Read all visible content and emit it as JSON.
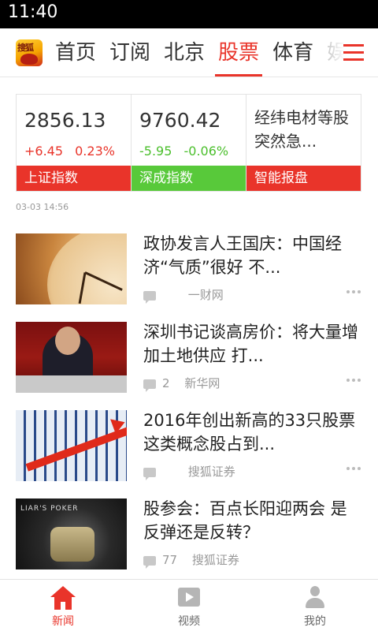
{
  "status_bar": {
    "time": "11:40"
  },
  "header": {
    "logo_text": "搜狐",
    "tabs": [
      {
        "label": "首页"
      },
      {
        "label": "订阅"
      },
      {
        "label": "北京"
      },
      {
        "label": "股票",
        "active": true
      },
      {
        "label": "体育"
      },
      {
        "label": "娱"
      }
    ],
    "menu_icon": "hamburger-menu-icon"
  },
  "market": {
    "indices": [
      {
        "value": "2856.13",
        "change": "+6.45",
        "percent": "0.23%",
        "name": "上证指数",
        "trend": "up",
        "color": "#e9342a"
      },
      {
        "value": "9760.42",
        "change": "-5.95",
        "percent": "-0.06%",
        "name": "深成指数",
        "trend": "down",
        "color": "#58c93a"
      }
    ],
    "smart_report": {
      "text": "经纬电材等股突然急...",
      "name": "智能报盘",
      "color": "#e9342a"
    }
  },
  "update_time": "03-03 14:56",
  "feed": [
    {
      "title": "政协发言人王国庆：中国经济“气质”很好 不...",
      "comments": "",
      "source": "一财网"
    },
    {
      "title": "深圳书记谈高房价：将大量增加土地供应 打...",
      "comments": "2",
      "source": "新华网"
    },
    {
      "title": "2016年创出新高的33只股票 这类概念股占到...",
      "comments": "",
      "source": "搜狐证券"
    },
    {
      "title": "股参会：百点长阳迎两会 是反弹还是反转？",
      "comments": "77",
      "source": "搜狐证券"
    }
  ],
  "bottom_nav": [
    {
      "label": "新闻",
      "icon": "home-icon",
      "active": true
    },
    {
      "label": "视频",
      "icon": "video-icon"
    },
    {
      "label": "我的",
      "icon": "user-icon"
    }
  ],
  "colors": {
    "accent": "#e9342a",
    "up": "#e9342a",
    "down": "#4bbf2c"
  },
  "thumb_captions": {
    "poker": "LIAR'S POKER"
  }
}
